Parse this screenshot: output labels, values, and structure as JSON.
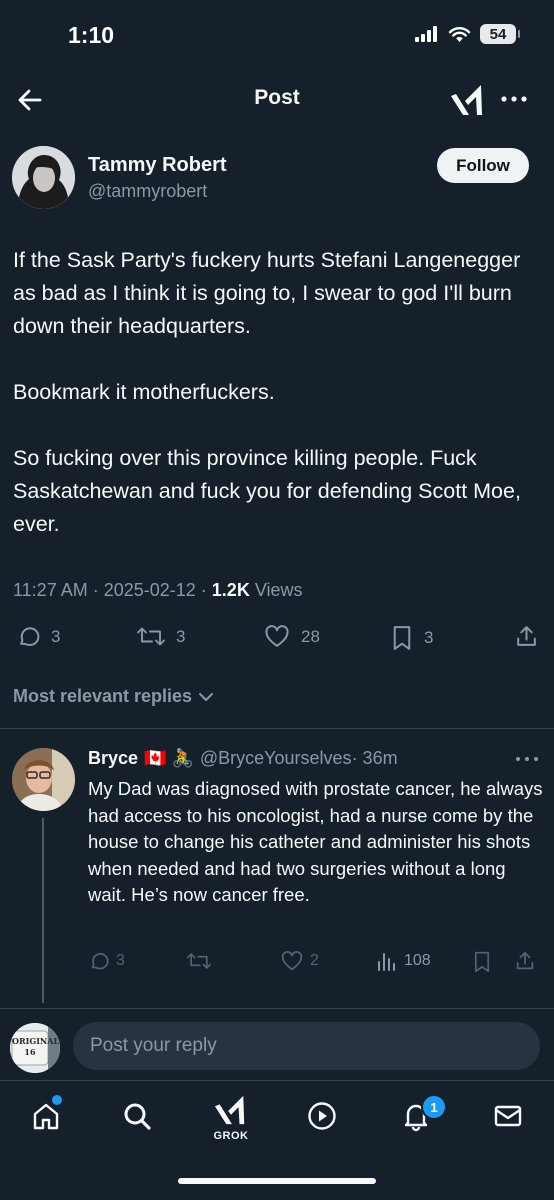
{
  "status_bar": {
    "time": "1:10",
    "battery": "54"
  },
  "header": {
    "title": "Post",
    "back_icon": "arrow-left-icon",
    "grok_icon": "grok-icon",
    "more_icon": "more-horizontal-icon"
  },
  "post": {
    "author_name": "Tammy Robert",
    "author_handle": "@tammyrobert",
    "follow_label": "Follow",
    "paragraphs": [
      "If the Sask Party's fuckery hurts Stefani Langenegger as bad as I think it is going to, I swear to god I'll burn down their headquarters.",
      "Bookmark it motherfuckers.",
      "So fucking over this province killing people. Fuck Saskatchewan and fuck you for defending Scott Moe, ever."
    ],
    "timestamp": "11:27 AM · 2025-02-12 · ",
    "views_count": "1.2K",
    "views_label": " Views",
    "actions": {
      "replies": "3",
      "reposts": "3",
      "likes": "28",
      "bookmarks": "3"
    }
  },
  "replies_section": {
    "sort_label": "Most relevant replies"
  },
  "reply": {
    "name": "Bryce",
    "emoji": "🇨🇦 🚴",
    "handle": "@BryceYourselves",
    "time": "· 36m",
    "text": "My Dad was diagnosed with prostate cancer, he always had access to his oncologist, had a nurse come by the house to change his catheter and administer his shots when needed and had two surgeries without a long wait. He’s now cancer free.",
    "actions": {
      "replies": "3",
      "likes": "2",
      "views": "108"
    }
  },
  "composer": {
    "placeholder": "Post your reply",
    "avatar_text": "ORIGINAL 16"
  },
  "tabbar": {
    "grok_label": "GROK",
    "notifications_badge": "1"
  },
  "colors": {
    "background": "#15202b",
    "accent": "#1d9bf0",
    "muted": "#8b98a5"
  }
}
